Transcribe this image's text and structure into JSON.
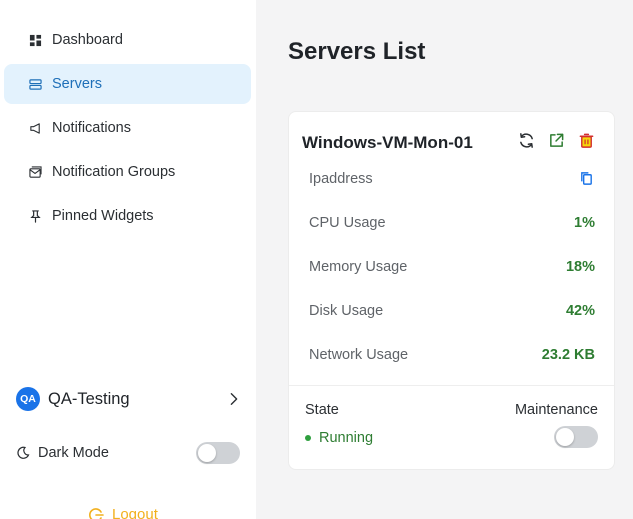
{
  "sidebar": {
    "items": [
      {
        "label": "Dashboard",
        "icon": "dashboard-icon"
      },
      {
        "label": "Servers",
        "icon": "servers-icon",
        "active": true
      },
      {
        "label": "Notifications",
        "icon": "megaphone-icon"
      },
      {
        "label": "Notification Groups",
        "icon": "mail-group-icon"
      },
      {
        "label": "Pinned Widgets",
        "icon": "pin-icon"
      }
    ],
    "user": {
      "initials": "QA",
      "name": "QA-Testing"
    },
    "dark_mode": {
      "label": "Dark Mode",
      "enabled": false
    },
    "logout_label": "Logout"
  },
  "main": {
    "title": "Servers List",
    "server_card": {
      "name": "Windows-VM-Mon-01",
      "metrics": [
        {
          "label": "Ipaddress",
          "value": ""
        },
        {
          "label": "CPU Usage",
          "value": "1%"
        },
        {
          "label": "Memory Usage",
          "value": "18%"
        },
        {
          "label": "Disk Usage",
          "value": "42%"
        },
        {
          "label": "Network Usage",
          "value": "23.2 KB"
        }
      ],
      "state_label": "State",
      "state_value": "Running",
      "maintenance_label": "Maintenance",
      "maintenance_enabled": false
    }
  },
  "colors": {
    "accent": "#1e6fb8",
    "active_bg": "#e3f2fd",
    "ok_green": "#2e7d32",
    "logout": "#f2b01e",
    "delete_yellow": "#f5d90a",
    "delete_red": "#d32f2f"
  }
}
